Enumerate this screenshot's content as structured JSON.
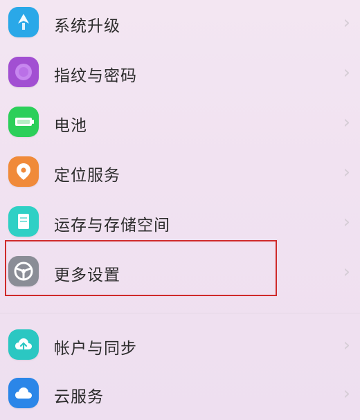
{
  "settings": {
    "items": [
      {
        "label": "系统升级",
        "icon": "system-update-icon",
        "color": "#2aa8e8"
      },
      {
        "label": "指纹与密码",
        "icon": "fingerprint-icon",
        "color": "#a24fd2"
      },
      {
        "label": "电池",
        "icon": "battery-icon",
        "color": "#2ccf5a"
      },
      {
        "label": "定位服务",
        "icon": "location-icon",
        "color": "#f08a3a"
      },
      {
        "label": "运存与存储空间",
        "icon": "storage-icon",
        "color": "#2fd0c5"
      },
      {
        "label": "更多设置",
        "icon": "more-settings-icon",
        "color": "#8a8d96"
      },
      {
        "label": "帐户与同步",
        "icon": "account-sync-icon",
        "color": "#2bc7c2"
      },
      {
        "label": "云服务",
        "icon": "cloud-service-icon",
        "color": "#2b86e8"
      }
    ],
    "highlighted_item": "更多设置",
    "highlight_color": "#cf2a2a",
    "chevron_char": "›"
  }
}
